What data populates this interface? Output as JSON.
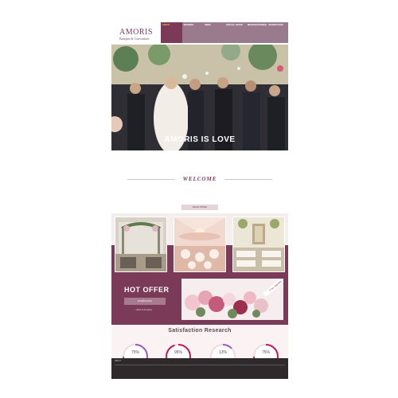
{
  "header": {
    "logo_main": "AMORIS",
    "logo_sub": "Banquet & Convention",
    "nav": [
      {
        "label": "ABOUT",
        "sub": [
          "",
          "",
          ""
        ]
      },
      {
        "label": "WEDDING",
        "sub": [
          "",
          "",
          ""
        ]
      },
      {
        "label": "MENU",
        "sub": [
          "",
          "",
          ""
        ]
      },
      {
        "label": "SPECIAL OFFER",
        "sub": [
          "",
          "",
          ""
        ]
      },
      {
        "label": "RESERVATION/INQUIRY",
        "sub": [
          "",
          "",
          ""
        ]
      },
      {
        "label": "RESERVATION",
        "sub": [
          "",
          "",
          ""
        ]
      }
    ]
  },
  "hero": {
    "title": "AMORIS IS LOVE",
    "subtitle": ""
  },
  "welcome": {
    "title": "WELCOME",
    "text": "",
    "read_more": "READ MORE"
  },
  "offer": {
    "title": "HOT OFFER",
    "download": "DOWNLOAD",
    "date": "→ 2018.12.31 (Mon)",
    "ribbon": "Free Upgrade"
  },
  "research": {
    "title": "Satisfaction Research",
    "items": [
      {
        "label": "Traffic",
        "value": "75%",
        "fraction": 0.75
      },
      {
        "label": "Wedding",
        "value": "95%",
        "fraction": 0.95
      },
      {
        "label": "Complaint",
        "value": "13%",
        "fraction": 0.13
      },
      {
        "label": "Effects",
        "value": "75%",
        "fraction": 0.75
      }
    ]
  },
  "footer": {
    "links": [
      "ABOUT",
      "",
      "",
      "",
      ""
    ],
    "family_site": "",
    "copyright": ""
  },
  "colors": {
    "brand": "#7b3a58",
    "accent": "#f5c24c",
    "gauge_a": "#9b59b6",
    "gauge_b": "#c2185b"
  }
}
